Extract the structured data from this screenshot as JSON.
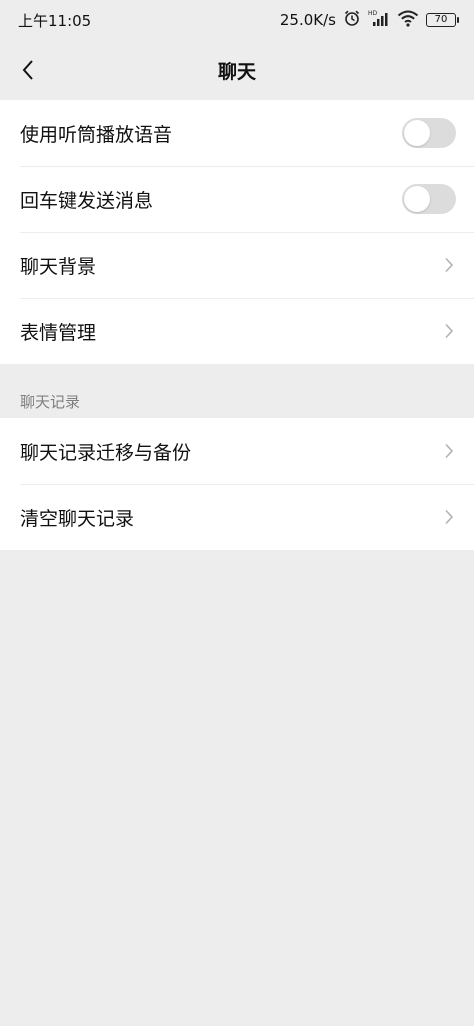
{
  "status_bar": {
    "time": "上午11:05",
    "network_speed": "25.0K/s",
    "battery_level": "70",
    "icons": [
      "alarm-icon",
      "hd-signal-icon",
      "wifi-icon",
      "battery-icon"
    ]
  },
  "nav": {
    "title": "聊天",
    "back_icon": "chevron-left-icon"
  },
  "settings": {
    "toggles": [
      {
        "label": "使用听筒播放语音",
        "enabled": false
      },
      {
        "label": "回车键发送消息",
        "enabled": false
      }
    ],
    "links": [
      {
        "label": "聊天背景"
      },
      {
        "label": "表情管理"
      }
    ]
  },
  "chat_history": {
    "section_title": "聊天记录",
    "items": [
      {
        "label": "聊天记录迁移与备份"
      },
      {
        "label": "清空聊天记录"
      }
    ]
  },
  "colors": {
    "background": "#ededed",
    "card": "#ffffff",
    "toggle_off": "#dcdcdc",
    "text_primary": "#111111",
    "text_secondary": "#7f7f7f",
    "chevron": "#b2b2b2"
  }
}
